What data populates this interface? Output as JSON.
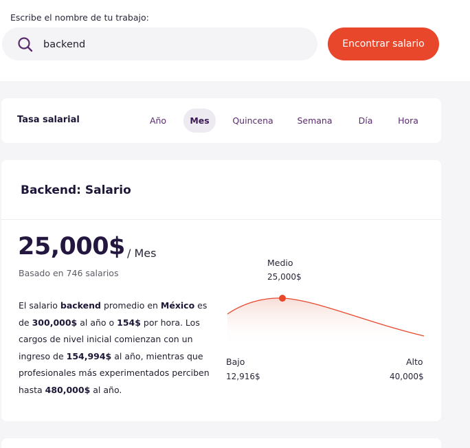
{
  "search": {
    "label": "Escribe el nombre de tu trabajo:",
    "value": "backend",
    "button": "Encontrar salario"
  },
  "rate": {
    "title": "Tasa salarial",
    "periods": [
      "Año",
      "Mes",
      "Quincena",
      "Semana",
      "Día",
      "Hora"
    ],
    "active": "Mes"
  },
  "salary": {
    "title": "Backend: Salario",
    "amount": "25,000$",
    "per": "/ Mes",
    "based_on": "Basado en 746 salarios",
    "desc": {
      "t1": "El salario ",
      "job": "backend",
      "t2": " promedio en ",
      "country": "México",
      "t3": " es de ",
      "year_amount": "300,000$",
      "t4": " al año o ",
      "hour_amount": "154$",
      "t5": " por hora. Los cargos de nivel inicial comienzan con un ingreso de ",
      "low_amount": "154,994$",
      "t6": " al año, mientras que profesionales más experimentados perciben hasta ",
      "high_amount": "480,000$",
      "t7": " al año."
    }
  },
  "distribution": {
    "median_label": "Medio",
    "median_value": "25,000$",
    "low_label": "Bajo",
    "low_value": "12,916$",
    "high_label": "Alto",
    "high_value": "40,000$"
  },
  "colors": {
    "accent": "#e8472b",
    "brand": "#3a1a54"
  }
}
